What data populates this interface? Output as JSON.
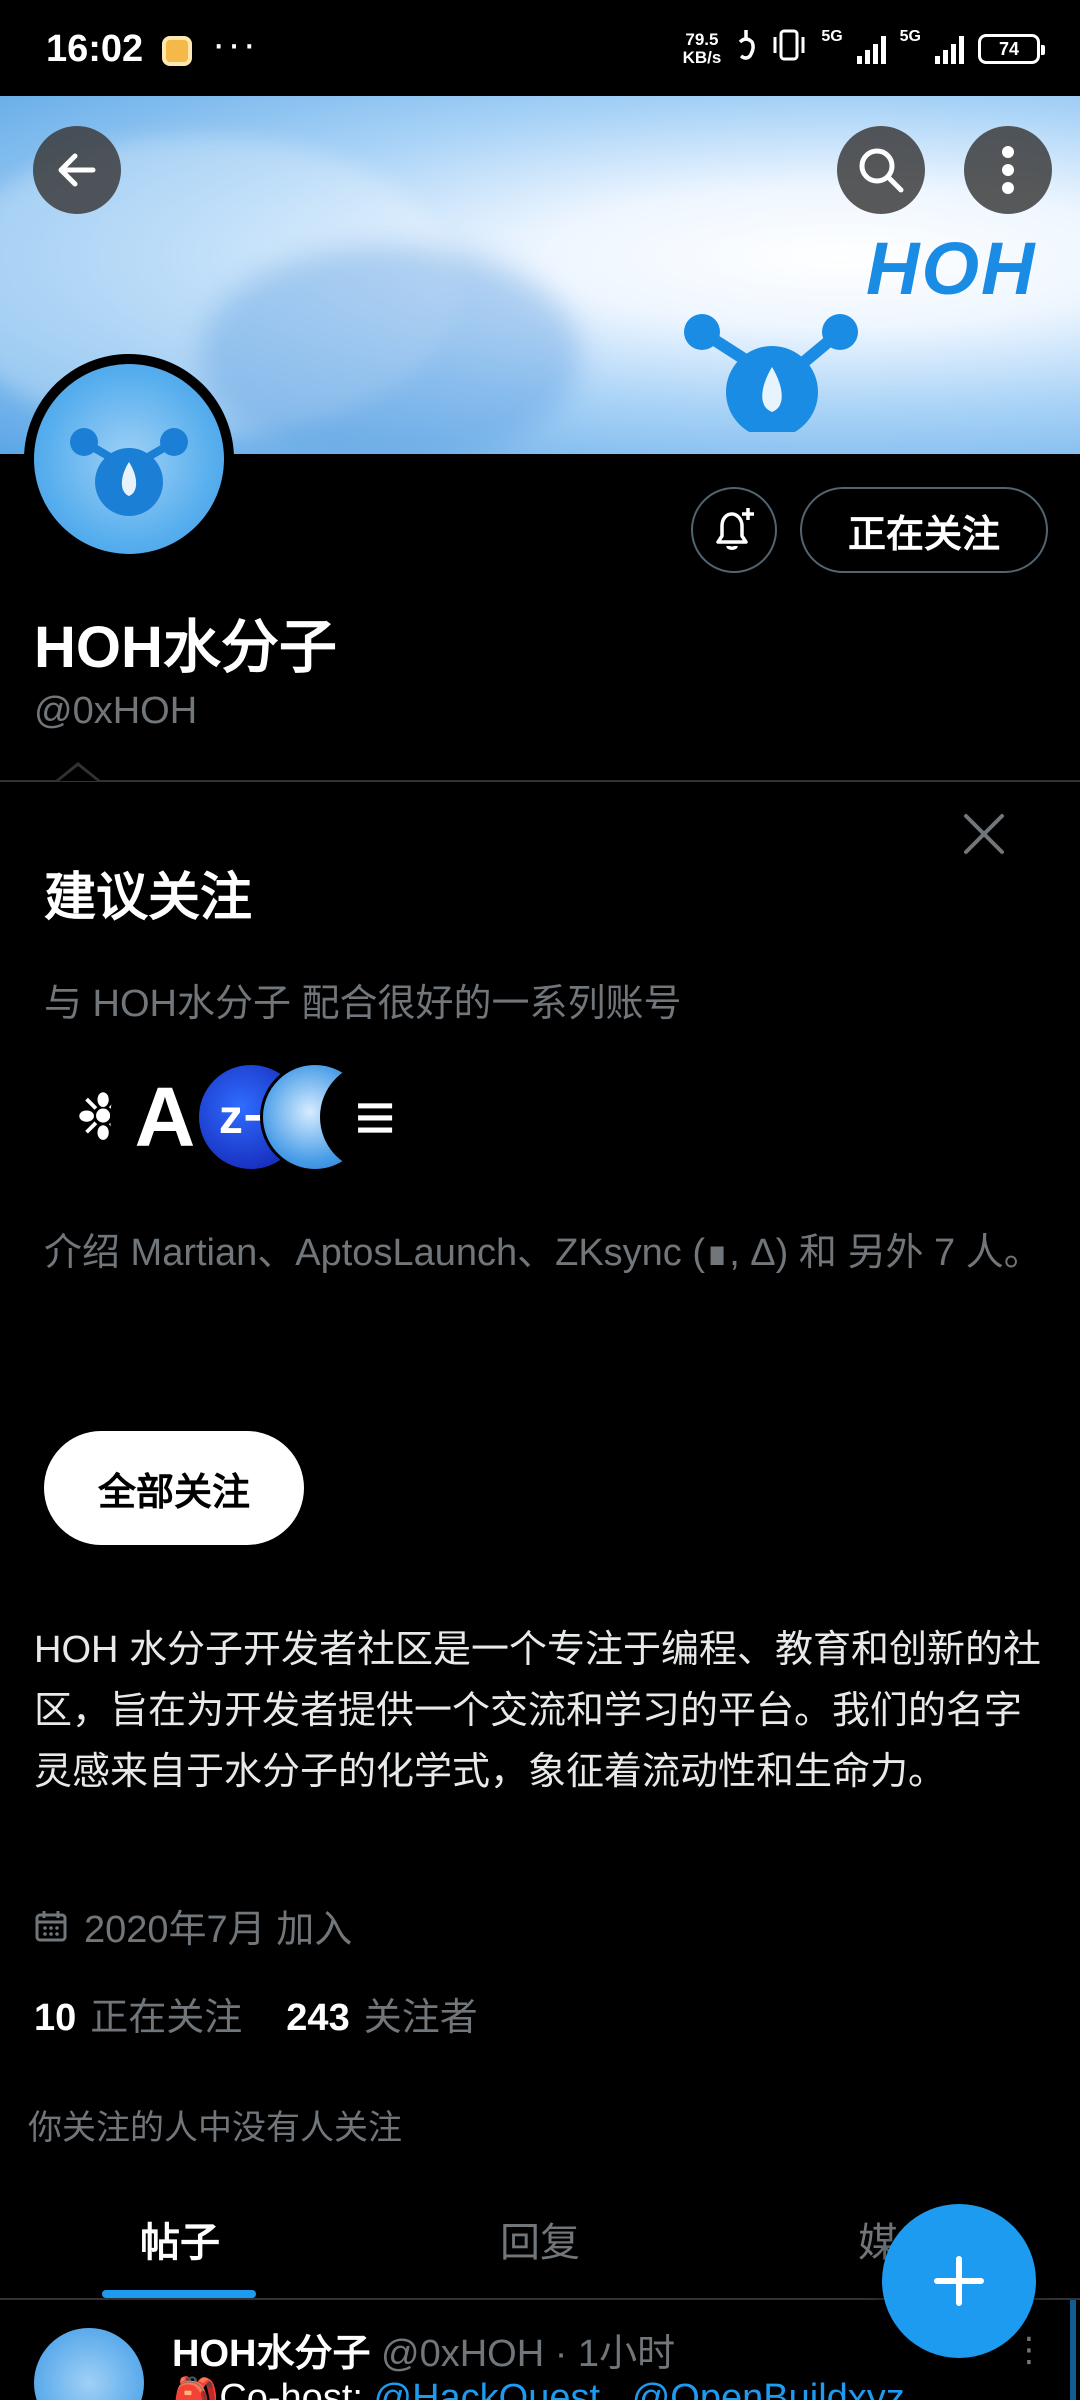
{
  "status_bar": {
    "time": "16:02",
    "net_speed_value": "79.5",
    "net_speed_unit": "KB/s",
    "signal_1": "5G",
    "signal_2": "5G",
    "battery": "74"
  },
  "banner": {
    "logo_text": "HOH"
  },
  "profile": {
    "display_name": "HOH水分子",
    "handle": "@0xHOH",
    "following_button": "正在关注"
  },
  "suggestions": {
    "title": "建议关注",
    "subtitle": "与 HOH水分子 配合很好的一系列账号",
    "description": "介绍 Martian、AptosLaunch、ZKsync (∎, Δ) 和 另外 7 人。",
    "follow_all_label": "全部关注",
    "avatars": [
      {
        "name": "Martian",
        "glyph": "❉",
        "color": "#000000"
      },
      {
        "name": "AptosLaunch",
        "glyph": "A",
        "color": "#000000"
      },
      {
        "name": "ZKsync",
        "glyph": "Z",
        "color": "#1e3fd6"
      },
      {
        "name": "swirl",
        "glyph": "",
        "color": "#5aa7ee"
      },
      {
        "name": "stack",
        "glyph": "≡",
        "color": "#000000"
      }
    ]
  },
  "bio": {
    "text": "HOH 水分子开发者社区是一个专注于编程、教育和创新的社区，旨在为开发者提供一个交流和学习的平台。我们的名字灵感来自于水分子的化学式，象征着流动性和生命力。",
    "joined": "2020年7月 加入"
  },
  "stats": {
    "following_count": "10",
    "following_label": "正在关注",
    "followers_count": "243",
    "followers_label": "关注者",
    "mutuals_note": "你关注的人中没有人关注"
  },
  "tabs": [
    {
      "label": "帖子",
      "active": true
    },
    {
      "label": "回复",
      "active": false
    },
    {
      "label": "媒",
      "active": false
    }
  ],
  "tweet": {
    "name": "HOH水分子",
    "handle_time": "@0xHOH · 1小时",
    "body_prefix": "🎒Co-host: ",
    "mention_1": "@HackQuest_",
    "mention_2": "@OpenBuildxyz"
  },
  "colors": {
    "accent": "#1d9bf0",
    "background": "#000000",
    "muted": "#71767b"
  }
}
